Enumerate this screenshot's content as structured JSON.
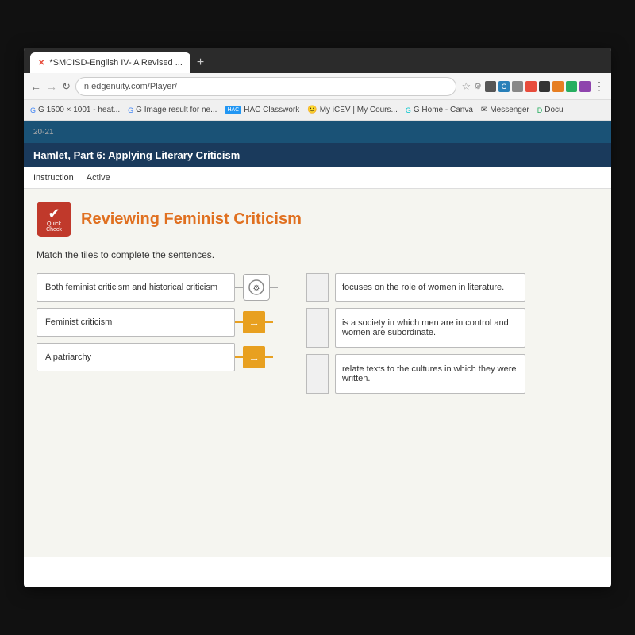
{
  "browser": {
    "tab_label": "*SMCISD-English IV- A Revised ...",
    "tab_plus": "+",
    "address": "n.edgenuity.com/Player/",
    "bookmarks": [
      {
        "label": "G 1500 × 1001 - heat..."
      },
      {
        "label": "G Image result for ne..."
      },
      {
        "label": "HAC Classwork"
      },
      {
        "label": "My iCEV | My Cours..."
      },
      {
        "label": "G Home - Canva"
      },
      {
        "label": "Messenger"
      },
      {
        "label": "Docu"
      }
    ]
  },
  "page": {
    "course_code": "20-21",
    "section_title": "Hamlet, Part 6: Applying Literary Criticism",
    "nav_items": [
      {
        "label": "Instruction",
        "active": true
      },
      {
        "label": "Active",
        "active": false
      }
    ],
    "quick_check_label": "Quick\nCheck",
    "title": "Reviewing Feminist Criticism",
    "instruction": "Match the tiles to complete the sentences.",
    "left_tiles": [
      {
        "id": 1,
        "text": "Both feminist criticism and historical criticism"
      },
      {
        "id": 2,
        "text": "Feminist criticism"
      },
      {
        "id": 3,
        "text": "A patriarchy"
      }
    ],
    "right_tiles": [
      {
        "id": 1,
        "text": "focuses on the role of women in literature."
      },
      {
        "id": 2,
        "text": "is a society in which men are in control and women are subordinate."
      },
      {
        "id": 3,
        "text": "relate texts to the cultures in which they were written."
      }
    ],
    "connectors": [
      {
        "type": "link",
        "row": 0
      },
      {
        "type": "arrow",
        "row": 1
      },
      {
        "type": "arrow",
        "row": 2
      }
    ]
  }
}
